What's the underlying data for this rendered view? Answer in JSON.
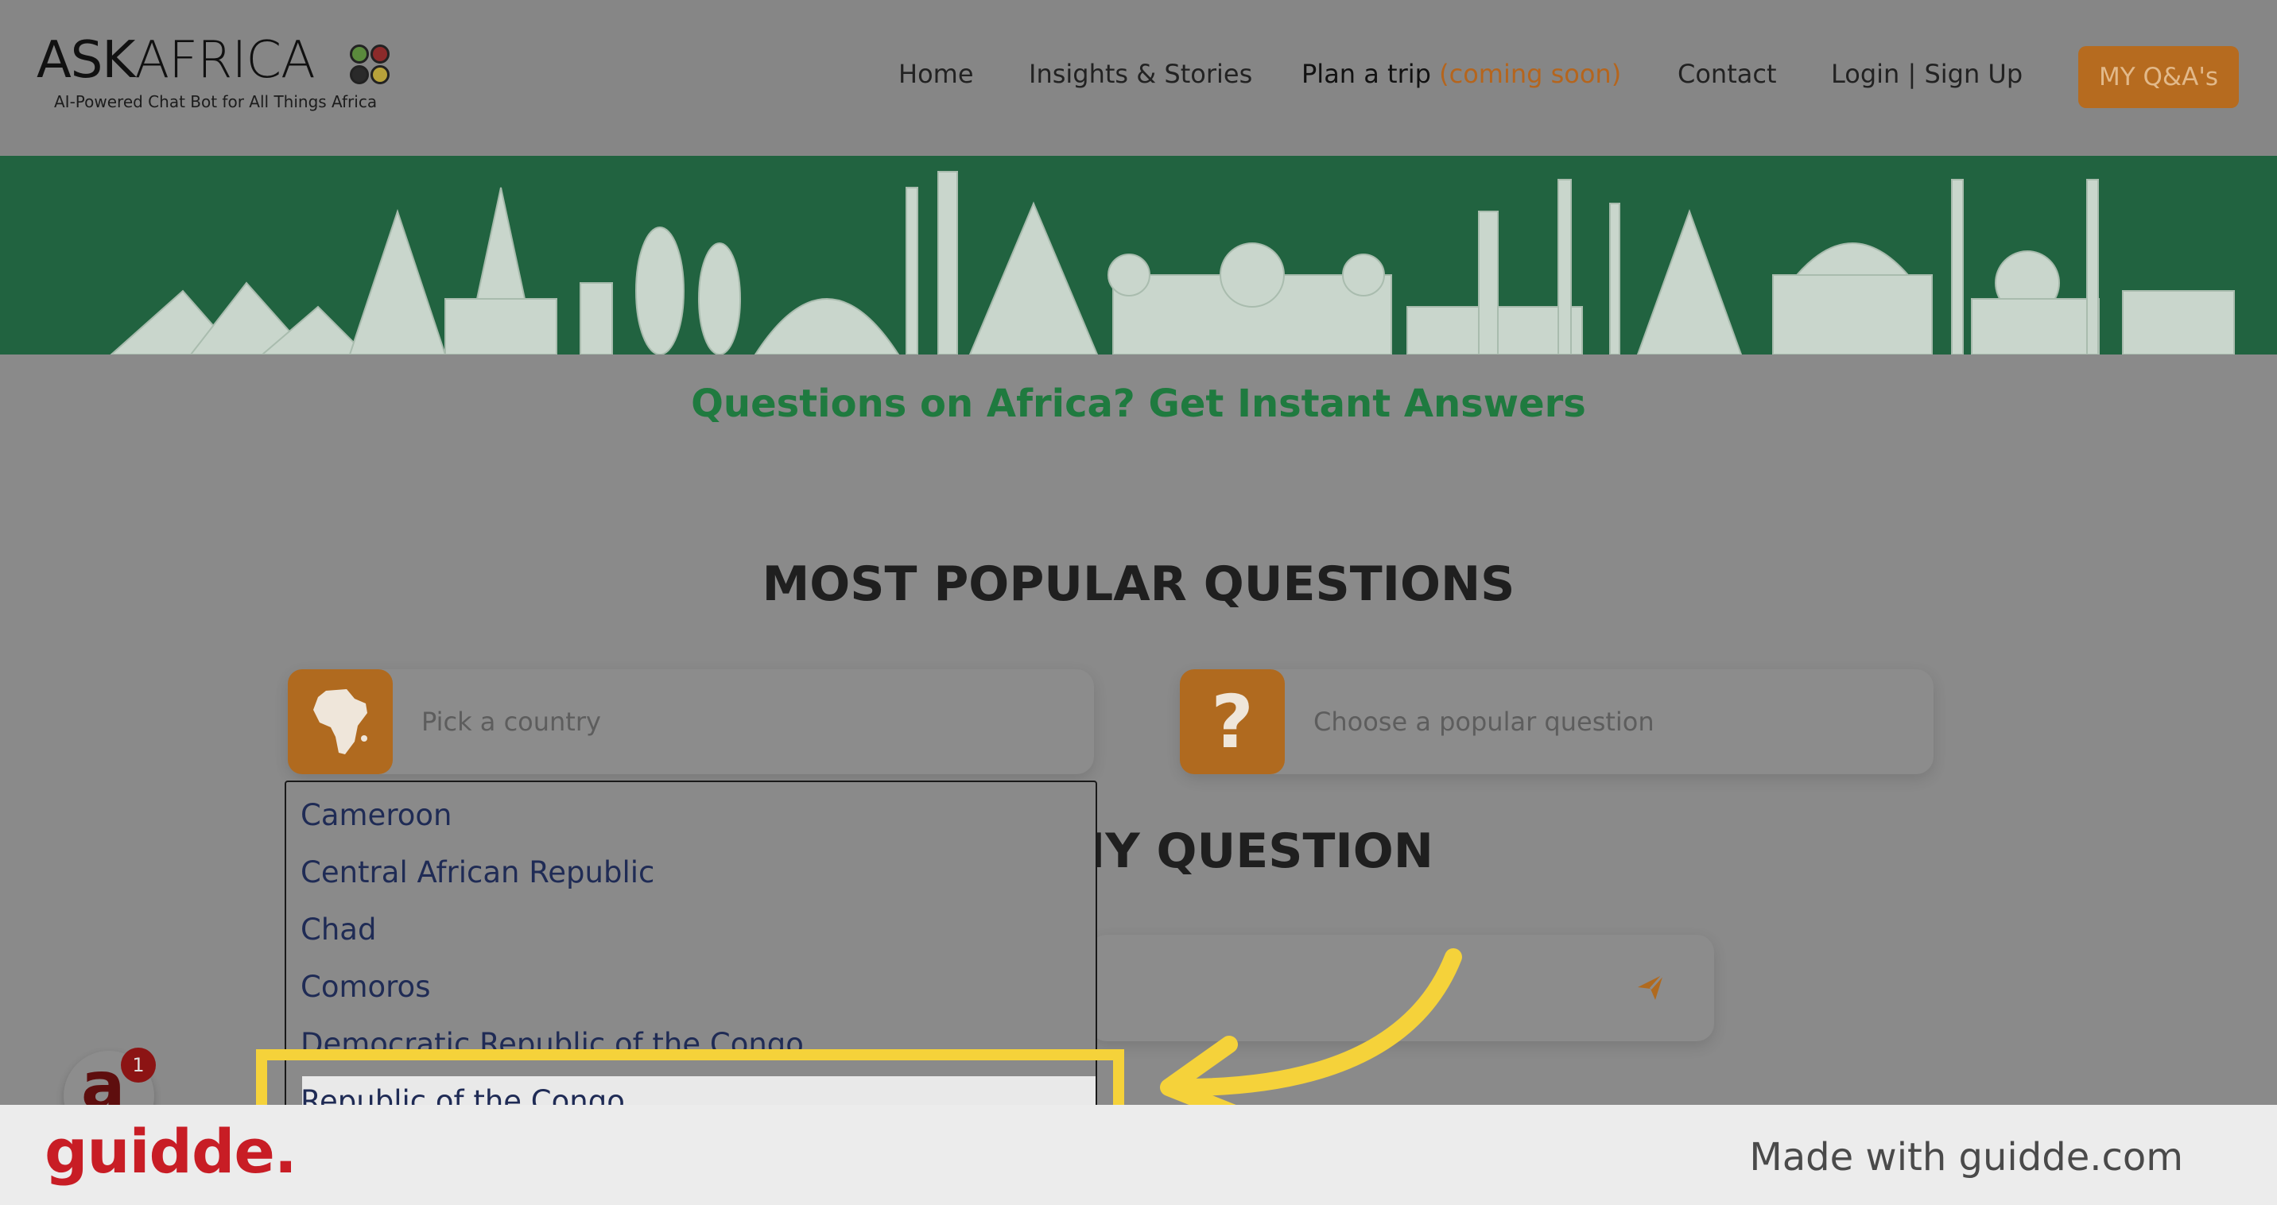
{
  "logo": {
    "word_bold": "ASK",
    "word_light": "AFRICA",
    "tagline": "AI-Powered Chat Bot for All Things Africa"
  },
  "nav": {
    "home": "Home",
    "insights": "Insights & Stories",
    "plan": "Plan a trip",
    "plan_note": "(coming soon)",
    "contact": "Contact",
    "login": "Login | Sign Up",
    "cta": "MY Q&A's"
  },
  "hero": {
    "tagline": "Questions on Africa? Get Instant Answers"
  },
  "popular": {
    "title": "MOST POPULAR QUESTIONS",
    "country_placeholder": "Pick a country",
    "question_placeholder": "Choose a popular question",
    "country_icon": "africa-map-icon",
    "question_icon": "question-mark-icon"
  },
  "ask": {
    "title_partial": "NY QUESTION",
    "send_icon": "send-icon"
  },
  "dropdown": {
    "items": [
      "Cameroon",
      "Central African Republic",
      "Chad",
      "Comoros",
      "Democratic Republic of the Congo",
      "Republic of the Congo"
    ],
    "highlighted_index": 5
  },
  "badge": {
    "letter": "a",
    "count": "1"
  },
  "footer": {
    "brand": "guidde.",
    "made_with": "Made with guidde.com"
  },
  "colors": {
    "banner": "#216340",
    "accent": "#b06a1f",
    "highlight": "#f5d23a",
    "brand": "#c81d25"
  }
}
